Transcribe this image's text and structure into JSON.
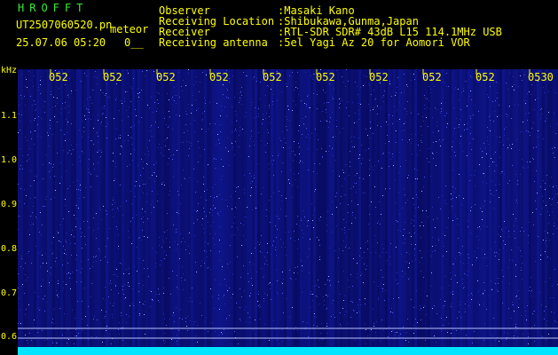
{
  "header": {
    "brand": "HROFFT",
    "filename": "UT2507060520.pn",
    "mode": "meteor",
    "datetime": "25.07.06 05:20",
    "counter": "0__",
    "info": [
      {
        "key": "Observer",
        "value": ":Masaki Kano"
      },
      {
        "key": "Receiving Location",
        "value": ":Shibukawa,Gunma,Japan"
      },
      {
        "key": "Receiver",
        "value": ":RTL-SDR SDR# 43dB L15 114.1MHz USB"
      },
      {
        "key": "Receiving antenna",
        "value": ":5el Yagi Az 20 for Aomori VOR"
      }
    ]
  },
  "axis": {
    "y_unit": "kHz",
    "y_ticks": [
      "1.1",
      "1.0",
      "0.9",
      "0.8",
      "0.7",
      "0.6"
    ],
    "x_ticks": [
      "052",
      "052",
      "052",
      "052",
      "052",
      "052",
      "052",
      "052",
      "052",
      "0530"
    ]
  },
  "colors": {
    "background": "#000000",
    "waterfall": "#0a0f6e",
    "text": "#ffff00",
    "brand": "#33ee33",
    "carrier": "#00e5ff"
  }
}
